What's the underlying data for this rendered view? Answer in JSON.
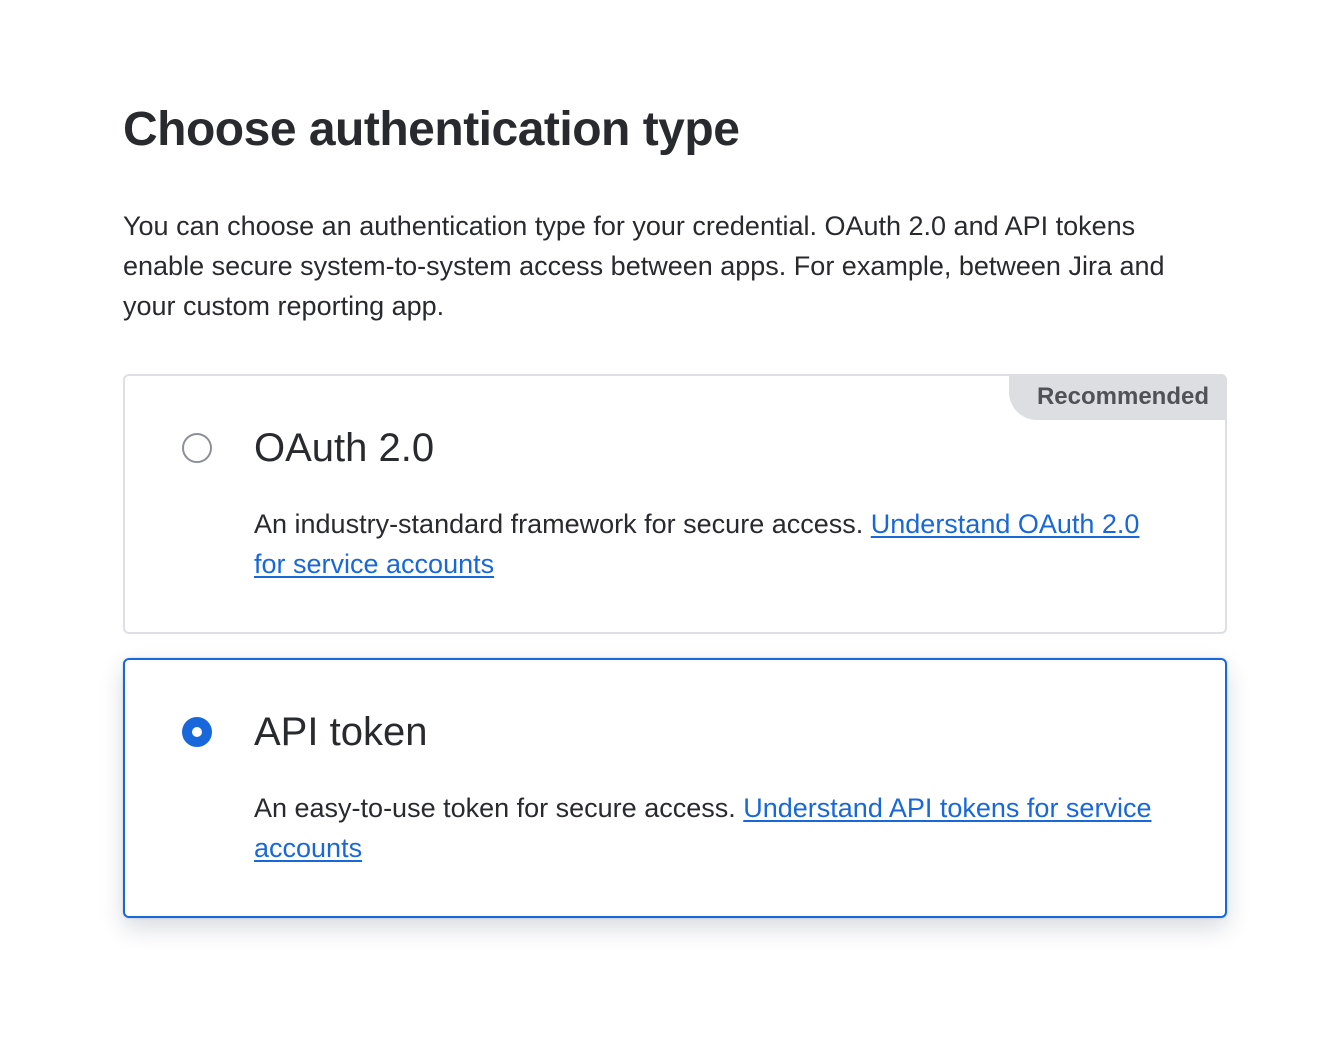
{
  "title": "Choose authentication type",
  "description": "You can choose an authentication type for your credential. OAuth 2.0 and API tokens enable secure system-to-system access between apps. For example, between Jira and your custom reporting app.",
  "options": [
    {
      "title": "OAuth 2.0",
      "badge": "Recommended",
      "description": "An industry-standard framework for secure access.",
      "link_text": "Understand OAuth 2.0 for service accounts",
      "selected": false
    },
    {
      "title": "API token",
      "description": "An easy-to-use token for secure access.",
      "link_text": "Understand API tokens for service accounts",
      "selected": true
    }
  ],
  "colors": {
    "accent": "#1868db",
    "text": "#292a2e",
    "border": "#dcdfe4",
    "badge_bg": "#dddee1"
  }
}
